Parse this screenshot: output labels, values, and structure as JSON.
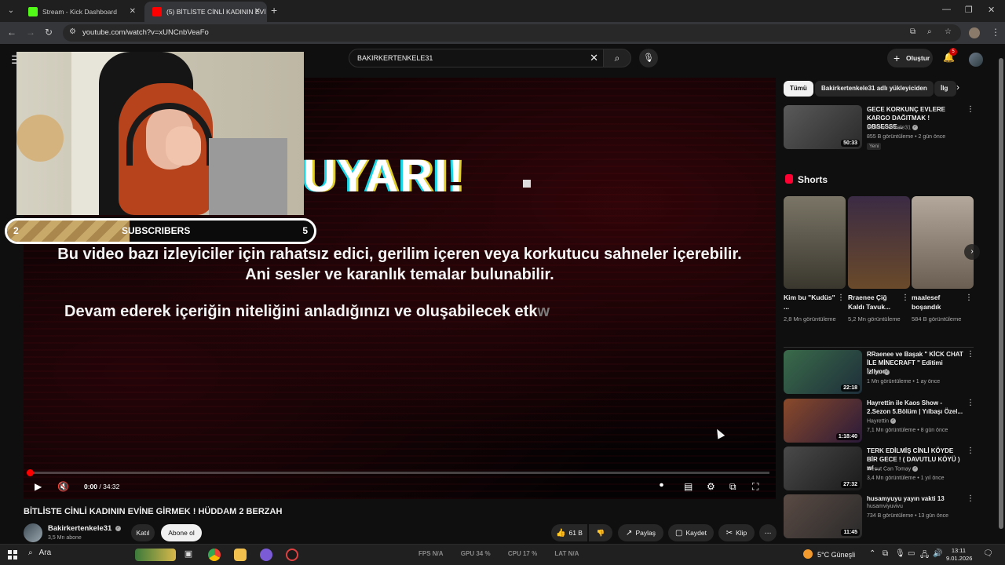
{
  "browser": {
    "tabs": [
      {
        "title": "Stream - Kick Dashboard",
        "favicon_color": "#53fc18"
      },
      {
        "title": "(5) BİTLİSTE CİNLİ KADININ EVİ",
        "favicon_color": "#ff0000"
      }
    ],
    "url": "youtube.com/watch?v=xUNCnbVeaFo"
  },
  "youtube": {
    "search_query": "BAKIRKERTENKELE31",
    "create_label": "Oluştur",
    "notification_count": "5"
  },
  "player": {
    "warning_title": "UYARI!",
    "warning_line1": "Bu video bazı izleyiciler için rahatsız edici, gerilim içeren veya korkutucu sahneler içerebilir. Ani sesler ve karanlık temalar bulunabilir.",
    "warning_line2_visible": "Devam ederek içeriğin niteliğini anladığınızı ve oluşabilecek etk",
    "warning_line2_fading": "w",
    "time_current": "0:00",
    "time_total": "34:32",
    "progress_fraction": 0
  },
  "overlay": {
    "subs_current": "2",
    "subs_label": "SUBSCRIBERS",
    "subs_target": "5",
    "goal_fill_fraction": 0.4
  },
  "video": {
    "title": "BİTLİSTE CİNLİ KADININ EVİNE GİRMEK ! HÜDDAM 2 BERZAH",
    "channel": "Bakirkertenkele31",
    "subscribers": "3,5 Mn abone",
    "join_label": "Katıl",
    "subscribe_label": "Abone ol",
    "likes": "61 B",
    "share_label": "Paylaş",
    "save_label": "Kaydet",
    "clip_label": "Klip"
  },
  "sidebar": {
    "chips": [
      "Tümü",
      "Bakirkertenkele31 adlı yükleyiciden",
      "İlg"
    ],
    "top_video": {
      "title": "GECE KORKUNÇ EVLERE KARGO DAĞITMAK ! OBSESSE...",
      "channel": "Bakirkertenkele31",
      "meta": "855 B görüntüleme • 2 gün önce",
      "badge": "Yeni",
      "duration": "50:33"
    },
    "shorts_title": "Shorts",
    "shorts": [
      {
        "title": "Kim bu \"Kudüs\" ...",
        "views": "2,8 Mn görüntüleme",
        "color": "#6f6a5c"
      },
      {
        "title": "Rraenee Çiğ Kaldı Tavuk...",
        "views": "5,2 Mn görüntüleme",
        "color": "#5b3a2a"
      },
      {
        "title": "maalesef boşandık",
        "views": "584 B görüntüleme",
        "color": "#8a7d72"
      }
    ],
    "videos": [
      {
        "title": "RRaenee ve Başak \" KİCK CHAT İLE MİNECRAFT \" Editimi İzliyor!",
        "channel": "Edixor",
        "meta": "1 Mn görüntüleme • 1 ay önce",
        "duration": "22:18",
        "color": "#3a6b4a"
      },
      {
        "title": "Hayrettin ile Kaos Show - 2.Sezon 5.Bölüm | Yılbaşı Özel...",
        "channel": "Hayrettin",
        "meta": "7,1 Mn görüntüleme • 8 gün önce",
        "duration": "1:18:40",
        "color": "#8a4a2a"
      },
      {
        "title": "TERK EDİLMİŞ CİNLİ KÖYDE BİR GECE ! ( DAVUTLU KÖYÜ ) w/ ...",
        "channel": "Mesut Can Tomay",
        "meta": "3,4 Mn görüntüleme • 1 yıl önce",
        "duration": "27:32",
        "color": "#4a4a4a"
      },
      {
        "title": "husamyuyu yayın vakti 13",
        "channel": "husamviyuvivu",
        "meta": "734 B görüntüleme • 13 gün önce",
        "duration": "11:45",
        "color": "#5a4a44"
      }
    ]
  },
  "taskbar": {
    "search_label": "Ara",
    "stats": [
      "FPS N/A",
      "GPU 34 %",
      "CPU 17 %",
      "LAT N/A"
    ],
    "weather": "5°C Güneşli",
    "time": "13:11",
    "date": "9.01.2026"
  }
}
